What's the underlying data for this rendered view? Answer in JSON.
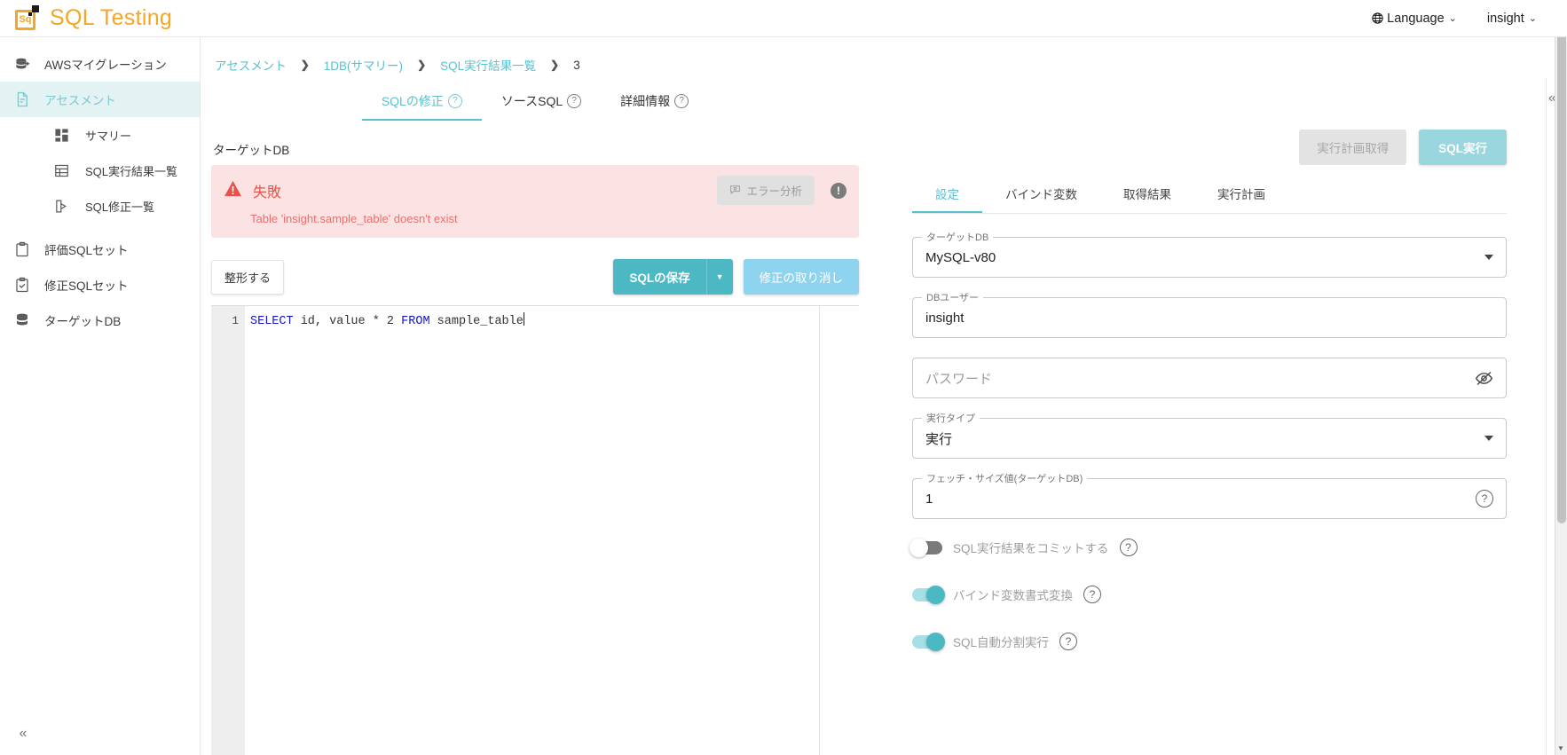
{
  "app": {
    "brand_title": "SQL Testing",
    "logo_text": "Sq"
  },
  "topbar": {
    "language_label": "Language",
    "language_caret": "⌄",
    "user_label": "insight",
    "user_caret": "⌄"
  },
  "sidebar": {
    "items": [
      {
        "label": "AWSマイグレーション",
        "icon": "database-arrow-icon",
        "active": false,
        "sub": false
      },
      {
        "label": "アセスメント",
        "icon": "document-icon",
        "active": true,
        "sub": false
      },
      {
        "label": "サマリー",
        "icon": "dashboard-icon",
        "active": false,
        "sub": true
      },
      {
        "label": "SQL実行結果一覧",
        "icon": "table-icon",
        "active": false,
        "sub": true
      },
      {
        "label": "SQL修正一覧",
        "icon": "edit-document-icon",
        "active": false,
        "sub": true
      },
      {
        "label": "評価SQLセット",
        "icon": "clipboard-icon",
        "active": false,
        "sub": false
      },
      {
        "label": "修正SQLセット",
        "icon": "clipboard-check-icon",
        "active": false,
        "sub": false
      },
      {
        "label": "ターゲットDB",
        "icon": "database-icon",
        "active": false,
        "sub": false
      }
    ],
    "collapse_label": "«"
  },
  "breadcrumb": {
    "separator": "❯",
    "items": [
      {
        "label": "アセスメント",
        "link": true
      },
      {
        "label": "1DB(サマリー)",
        "link": true
      },
      {
        "label": "SQL実行結果一覧",
        "link": true
      },
      {
        "label": "3",
        "link": false
      }
    ]
  },
  "main_tabs": [
    {
      "label": "SQLの修正",
      "help": "?",
      "active": true
    },
    {
      "label": "ソースSQL",
      "help": "?",
      "active": false
    },
    {
      "label": "詳細情報",
      "help": "?",
      "active": false
    }
  ],
  "target_db_section": {
    "label": "ターゲットDB"
  },
  "alert": {
    "icon": "warning-triangle-icon",
    "title": "失敗",
    "message": "Table 'insight.sample_table' doesn't exist",
    "analyze_button": "エラー分析",
    "analyze_icon": "speech-bubble-icon",
    "info_icon": "!",
    "bg_color": "#fbe3e3",
    "text_color": "#e8524a"
  },
  "editor_toolbar": {
    "format_button": "整形する",
    "save_button": "SQLの保存",
    "save_dropdown_caret": "▼",
    "undo_button": "修正の取り消し"
  },
  "editor": {
    "line_numbers": [
      "1"
    ],
    "code_tokens": [
      {
        "text": "SELECT",
        "type": "keyword"
      },
      {
        "text": " id, value * 2 ",
        "type": "plain"
      },
      {
        "text": "FROM",
        "type": "keyword"
      },
      {
        "text": " sample_table",
        "type": "plain"
      }
    ],
    "code_plain": "SELECT id, value * 2 FROM sample_table"
  },
  "right_panel": {
    "plan_button": "実行計画取得",
    "run_button": "SQL実行",
    "tabs": [
      {
        "label": "設定",
        "active": true
      },
      {
        "label": "バインド変数",
        "active": false
      },
      {
        "label": "取得結果",
        "active": false
      },
      {
        "label": "実行計画",
        "active": false
      }
    ],
    "fields": [
      {
        "legend": "ターゲットDB",
        "value": "MySQL-v80",
        "placeholder": "",
        "icon": "chevron-down-icon",
        "type": "select"
      },
      {
        "legend": "DBユーザー",
        "value": "insight",
        "placeholder": "",
        "icon": "",
        "type": "text"
      },
      {
        "legend": "",
        "value": "",
        "placeholder": "パスワード",
        "icon": "eye-off-icon",
        "type": "password"
      },
      {
        "legend": "実行タイプ",
        "value": "実行",
        "placeholder": "",
        "icon": "chevron-down-icon",
        "type": "select"
      },
      {
        "legend": "フェッチ・サイズ値(ターゲットDB)",
        "value": "1",
        "placeholder": "",
        "icon": "help-icon",
        "type": "text"
      }
    ],
    "toggles": [
      {
        "label": "SQL実行結果をコミットする",
        "on": false,
        "help": "?"
      },
      {
        "label": "バインド変数書式変換",
        "on": true,
        "help": "?"
      },
      {
        "label": "SQL自動分割実行",
        "on": true,
        "help": "?"
      }
    ]
  },
  "right_rail": {
    "collapse_label": "«"
  },
  "colors": {
    "accent": "#5bc0cd",
    "brand": "#f5a623",
    "danger": "#e8524a",
    "toggle_on": "#4cb8c4"
  }
}
